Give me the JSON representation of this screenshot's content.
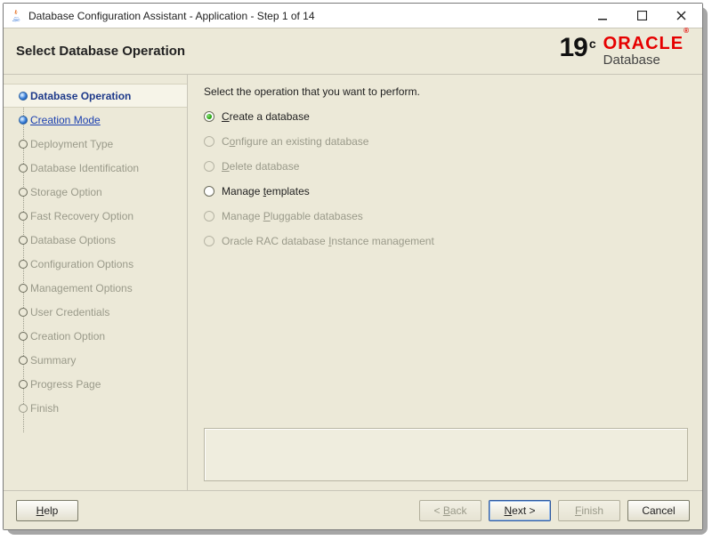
{
  "window": {
    "title": "Database Configuration Assistant - Application - Step 1 of 14"
  },
  "header": {
    "title": "Select Database Operation"
  },
  "logo": {
    "version": "19",
    "suffix": "c",
    "brand": "ORACLE",
    "tm": "®",
    "product": "Database"
  },
  "sidebar": {
    "items": [
      {
        "label": "Database Operation",
        "state": "current"
      },
      {
        "label": "Creation Mode",
        "state": "link"
      },
      {
        "label": "Deployment Type",
        "state": "disabled"
      },
      {
        "label": "Database Identification",
        "state": "disabled"
      },
      {
        "label": "Storage Option",
        "state": "disabled"
      },
      {
        "label": "Fast Recovery Option",
        "state": "disabled"
      },
      {
        "label": "Database Options",
        "state": "disabled"
      },
      {
        "label": "Configuration Options",
        "state": "disabled"
      },
      {
        "label": "Management Options",
        "state": "disabled"
      },
      {
        "label": "User Credentials",
        "state": "disabled"
      },
      {
        "label": "Creation Option",
        "state": "disabled"
      },
      {
        "label": "Summary",
        "state": "disabled"
      },
      {
        "label": "Progress Page",
        "state": "disabled"
      },
      {
        "label": "Finish",
        "state": "disabled"
      }
    ]
  },
  "content": {
    "instruction": "Select the operation that you want to perform.",
    "options": [
      {
        "pre": "",
        "mn": "C",
        "post": "reate a database",
        "state": "selected"
      },
      {
        "pre": "C",
        "mn": "o",
        "post": "nfigure an existing database",
        "state": "disabled"
      },
      {
        "pre": "",
        "mn": "D",
        "post": "elete database",
        "state": "disabled"
      },
      {
        "pre": "Manage ",
        "mn": "t",
        "post": "emplates",
        "state": "enabled"
      },
      {
        "pre": "Manage ",
        "mn": "P",
        "post": "luggable databases",
        "state": "disabled"
      },
      {
        "pre": "Oracle RAC database ",
        "mn": "I",
        "post": "nstance management",
        "state": "disabled"
      }
    ]
  },
  "footer": {
    "help_mn": "H",
    "help_post": "elp",
    "back_pre": "< ",
    "back_mn": "B",
    "back_post": "ack",
    "next_mn": "N",
    "next_post": "ext >",
    "finish_mn": "F",
    "finish_post": "inish",
    "cancel": "Cancel"
  }
}
